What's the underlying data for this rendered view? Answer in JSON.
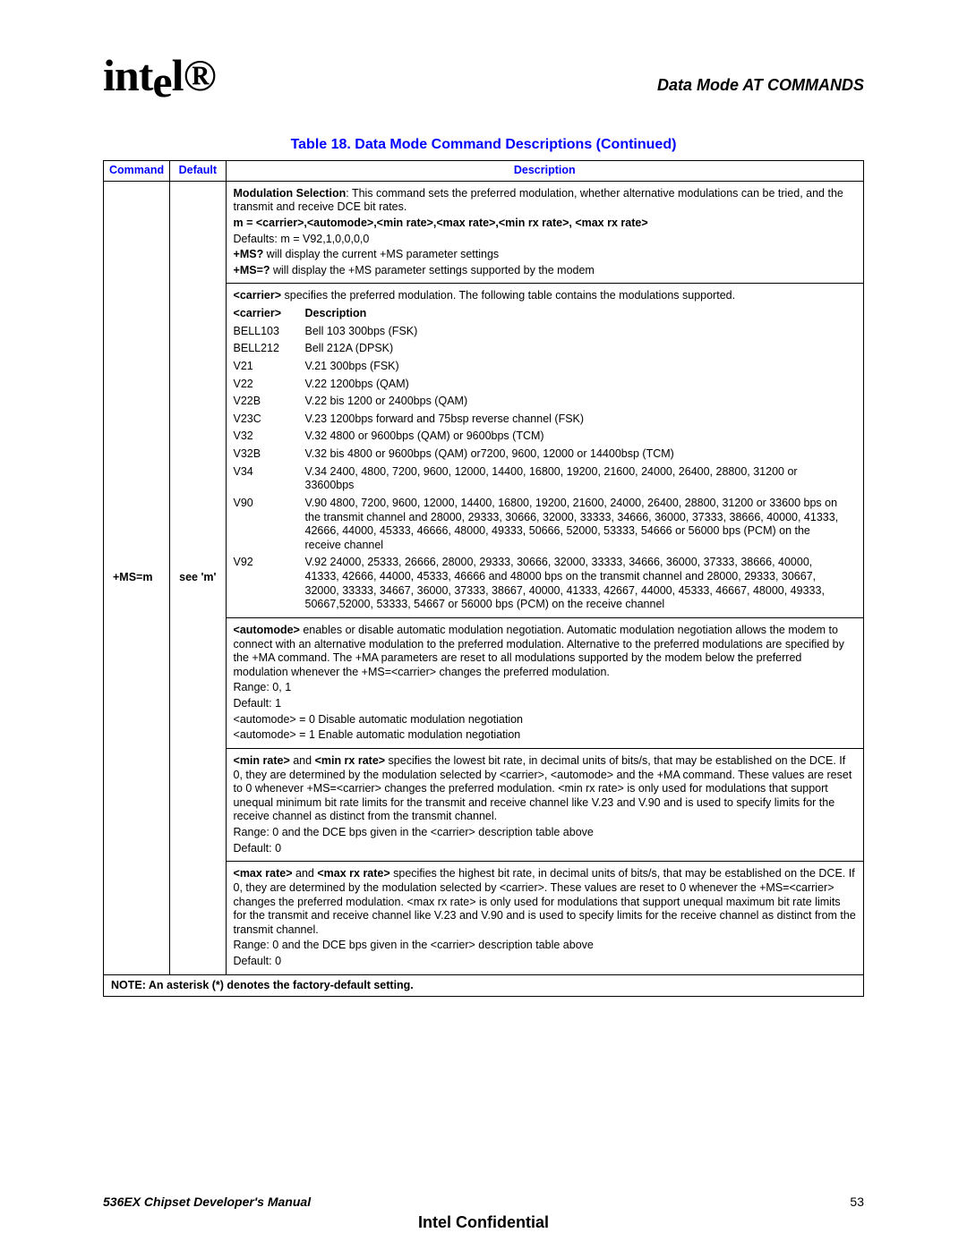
{
  "header": {
    "logo_text": "intel",
    "chapter_title": "Data Mode AT COMMANDS"
  },
  "table_caption": "Table 18. Data Mode Command Descriptions (Continued)",
  "columns": {
    "c1": "Command",
    "c2": "Default",
    "c3": "Description"
  },
  "row": {
    "command": "+MS=m",
    "default": "see 'm'",
    "intro_lead": "Modulation Selection",
    "intro_rest": ": This command sets the preferred modulation, whether alternative modulations can be tried, and the transmit and receive DCE bit rates.",
    "m_syntax": "m = <carrier>,<automode>,<min rate>,<max rate>,<min rx rate>, <max rx rate>",
    "defaults_line": "Defaults: m = V92,1,0,0,0,0",
    "msq_lead": "+MS?",
    "msq_rest": " will display the current +MS parameter settings",
    "mseq_lead": "+MS=?",
    "mseq_rest": " will display the +MS parameter settings supported by the modem",
    "carrier_lead": "<carrier>",
    "carrier_rest": " specifies the preferred modulation. The following table contains the modulations supported.",
    "inner_hdr_c": "<carrier>",
    "inner_hdr_d": "Description",
    "carriers": [
      {
        "c": "BELL103",
        "d": "Bell 103 300bps (FSK)"
      },
      {
        "c": "BELL212",
        "d": "Bell 212A (DPSK)"
      },
      {
        "c": "V21",
        "d": "V.21 300bps (FSK)"
      },
      {
        "c": "V22",
        "d": "V.22 1200bps (QAM)"
      },
      {
        "c": "V22B",
        "d": "V.22 bis 1200 or 2400bps (QAM)"
      },
      {
        "c": "V23C",
        "d": "V.23 1200bps forward and 75bsp reverse channel (FSK)"
      },
      {
        "c": "V32",
        "d": "V.32 4800 or 9600bps (QAM) or 9600bps (TCM)"
      },
      {
        "c": "V32B",
        "d": "V.32 bis 4800 or 9600bps (QAM) or7200, 9600, 12000 or 14400bsp (TCM)"
      },
      {
        "c": "V34",
        "d": "V.34 2400, 4800, 7200, 9600, 12000, 14400, 16800, 19200, 21600, 24000, 26400, 28800, 31200 or 33600bps"
      },
      {
        "c": "V90",
        "d": "V.90 4800, 7200, 9600, 12000, 14400, 16800, 19200, 21600, 24000, 26400, 28800, 31200 or 33600 bps on the transmit channel and 28000, 29333, 30666, 32000, 33333, 34666, 36000, 37333, 38666, 40000, 41333, 42666, 44000, 45333, 46666, 48000, 49333, 50666, 52000, 53333, 54666 or 56000 bps (PCM) on the receive channel"
      },
      {
        "c": "V92",
        "d": "V.92 24000, 25333, 26666, 28000, 29333, 30666, 32000, 33333, 34666, 36000, 37333, 38666, 40000, 41333, 42666, 44000, 45333, 46666 and 48000 bps on the transmit channel and 28000, 29333, 30667, 32000, 33333, 34667, 36000, 37333, 38667, 40000, 41333, 42667, 44000, 45333, 46667, 48000, 49333, 50667,52000, 53333, 54667 or 56000 bps (PCM) on the receive channel"
      }
    ],
    "automode_lead": "<automode>",
    "automode_rest": " enables or disable automatic modulation negotiation. Automatic modulation negotiation allows the modem to connect with an alternative modulation to the preferred modulation. Alternative to the preferred modulations are specified by the +MA command. The +MA parameters are reset to all modulations supported by the modem below the preferred modulation whenever the +MS=<carrier> changes the preferred modulation.",
    "automode_range": "Range: 0, 1",
    "automode_default": "Default: 1",
    "automode_0": "<automode> = 0 Disable automatic modulation negotiation",
    "automode_1": "<automode> = 1 Enable automatic modulation negotiation",
    "min_lead1": "<min rate>",
    "min_mid": " and ",
    "min_lead2": "<min rx rate>",
    "min_rest": " specifies the lowest bit rate, in decimal units of bits/s, that may be established on the DCE. If 0, they are determined by the modulation selected by <carrier>, <automode> and the +MA command. These values are reset to 0 whenever +MS=<carrier> changes the preferred modulation. <min rx rate> is only used for modulations that support unequal minimum bit rate limits for the transmit and receive channel like V.23 and V.90 and is used to specify limits for the receive channel as distinct from the transmit channel.",
    "min_range": "Range: 0 and the DCE bps given in the <carrier> description table above",
    "min_default": "Default: 0",
    "max_lead1": "<max rate>",
    "max_lead2": "<max rx rate>",
    "max_rest": " specifies the highest bit rate, in decimal units of bits/s, that may be established on the DCE. If 0, they are determined by the modulation selected by <carrier>. These values are reset to 0 whenever the +MS=<carrier> changes the preferred modulation. <max rx rate> is only used for modulations that support unequal maximum bit rate limits for the transmit and receive channel like V.23 and V.90 and is used to specify limits for the receive channel as distinct from the transmit channel.",
    "max_range": "Range: 0 and the DCE bps given in the <carrier> description table above",
    "max_default": "Default: 0"
  },
  "note": "NOTE:  An asterisk (*) denotes the factory-default setting.",
  "footer": {
    "manual_title": "536EX Chipset Developer's Manual",
    "page_no": "53",
    "confidential": "Intel Confidential"
  }
}
